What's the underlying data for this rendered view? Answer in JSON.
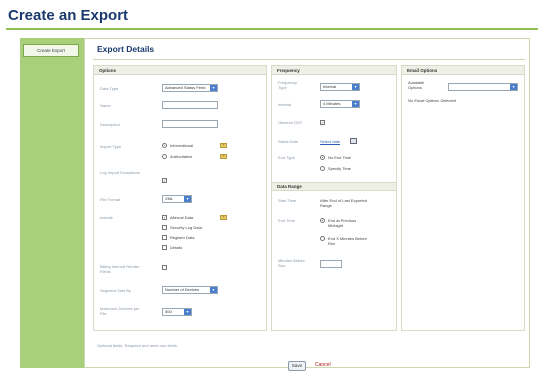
{
  "page": {
    "title": "Create an Export"
  },
  "sidebar": {
    "tab_label": "Create Export"
  },
  "main": {
    "section_title": "Export Details"
  },
  "options": {
    "heading": "Options",
    "data_type": {
      "label": "Data Type",
      "value": "Advanced Status Feed"
    },
    "name": {
      "label": "Name",
      "value": ""
    },
    "description": {
      "label": "Description",
      "value": ""
    },
    "import_type": {
      "label": "Import Type",
      "opt1": "Informational",
      "opt2": "Authoritative"
    },
    "log_import": {
      "label": "Log Import Exceptions"
    },
    "file_format": {
      "label": "File Format",
      "value": "XML"
    },
    "include": {
      "label": "Include",
      "items": [
        "Alternal Data",
        "Security Log Data",
        "Register Data",
        "Details"
      ]
    },
    "billing": {
      "label": "Billing Internal Render Fields"
    },
    "segment": {
      "label": "Segment Sets By",
      "value": "Number of Devices"
    },
    "maximum": {
      "label": "Maximum Devices per File",
      "value": "500"
    }
  },
  "frequency": {
    "heading": "Frequency",
    "type": {
      "label": "Frequency Type",
      "value": "Interval"
    },
    "interval": {
      "label": "Interval",
      "value": "4 Minutes"
    },
    "observe_dst": {
      "label": "Observe DST"
    },
    "starts_date": {
      "label": "Starts Date",
      "value": "Select date"
    },
    "end_type": {
      "label": "End Type",
      "opt1": "No End Time",
      "opt2": "Specify Time"
    }
  },
  "data_range": {
    "heading": "Data Range",
    "start_time": {
      "label": "Start Time",
      "value": "After End of Last Exported Range"
    },
    "end_time": {
      "label": "End Time",
      "opt1": "End at Previous Midnight",
      "opt2": "End X Minutes Before Run"
    },
    "minutes": {
      "label": "Minutes Before Run",
      "value": ""
    }
  },
  "email": {
    "heading": "Email Options",
    "available": {
      "label": "Available Options",
      "value": ""
    },
    "none_text": "No Email Options Selected"
  },
  "footer": {
    "note": "Optional fields. Required and meet one fields.",
    "save_label": "Save",
    "cancel_label": "Cancel"
  },
  "colors": {
    "title": "#1a3a6e",
    "sidebar": "#a8cf7a",
    "accent": "#8fbf4f",
    "cancel": "#b01515"
  }
}
